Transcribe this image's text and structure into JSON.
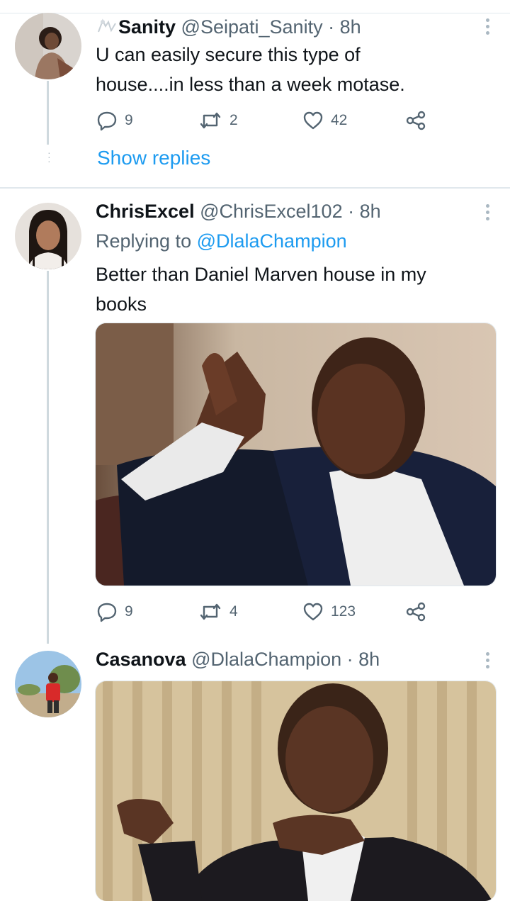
{
  "tweets": [
    {
      "name": "Sanity",
      "handle": "@Seipati_Sanity",
      "time": "8h",
      "text": "U can easily secure this type of house....in less than a week motase.",
      "replies": "9",
      "retweets": "2",
      "likes": "42",
      "show_replies": "Show replies"
    },
    {
      "name": "ChrisExcel",
      "handle": "@ChrisExcel102",
      "time": "8h",
      "replying_prefix": "Replying to",
      "replying_to": "@DlalaChampion",
      "text": "Better than Daniel Marven house in my books",
      "replies": "9",
      "retweets": "4",
      "likes": "123"
    },
    {
      "name": "Casanova",
      "handle": "@DlalaChampion",
      "time": "8h"
    }
  ],
  "separator": "·",
  "colors": {
    "accent": "#1d9bf0",
    "muted": "#536471",
    "divider": "#e1e8ed"
  },
  "icons": [
    "reply-icon",
    "retweet-icon",
    "like-icon",
    "share-icon",
    "more-icon"
  ]
}
